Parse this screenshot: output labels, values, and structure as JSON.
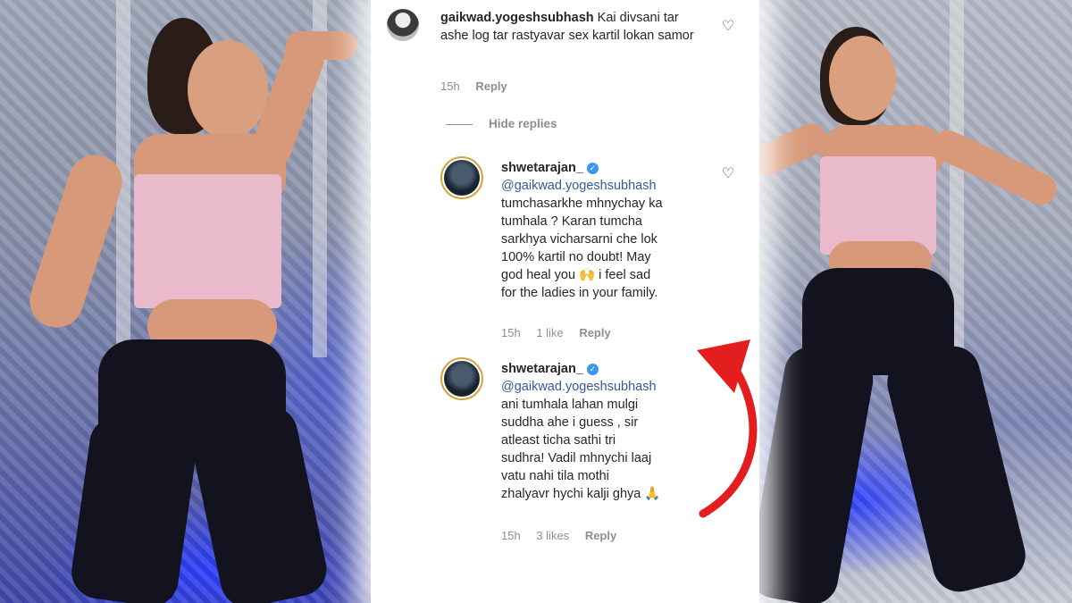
{
  "comments": [
    {
      "username": "gaikwad.yogeshsubhash",
      "text": "Kai divsani tar ashe log tar rastyavar sex kartil lokan samor",
      "time": "15h",
      "reply_label": "Reply",
      "avatar_icon": "user-avatar"
    }
  ],
  "hide_replies_label": "Hide replies",
  "replies": [
    {
      "username": "shwetarajan_",
      "verified": true,
      "mention": "@gaikwad.yogeshsubhash",
      "lines": [
        "tumchasarkhe mhnychay ka",
        "tumhala ? Karan tumcha",
        "sarkhya vicharsarni che lok",
        "100% kartil no doubt! May",
        "god heal you 🙌 i feel sad",
        "for the ladies in your family."
      ],
      "time": "15h",
      "likes": "1 like",
      "reply_label": "Reply"
    },
    {
      "username": "shwetarajan_",
      "verified": true,
      "mention": "@gaikwad.yogeshsubhash",
      "lines": [
        "ani tumhala lahan mulgi",
        "suddha ahe i guess , sir",
        "atleast ticha sathi tri",
        "sudhra! Vadil mhnychi laaj",
        "vatu nahi tila mothi",
        "zhalyavr hychi kalji ghya 🙏"
      ],
      "time": "15h",
      "likes": "3 likes",
      "reply_label": "Reply"
    }
  ],
  "colors": {
    "arrow": "#e41e1e",
    "mention": "#385898",
    "verified": "#3897f0"
  }
}
